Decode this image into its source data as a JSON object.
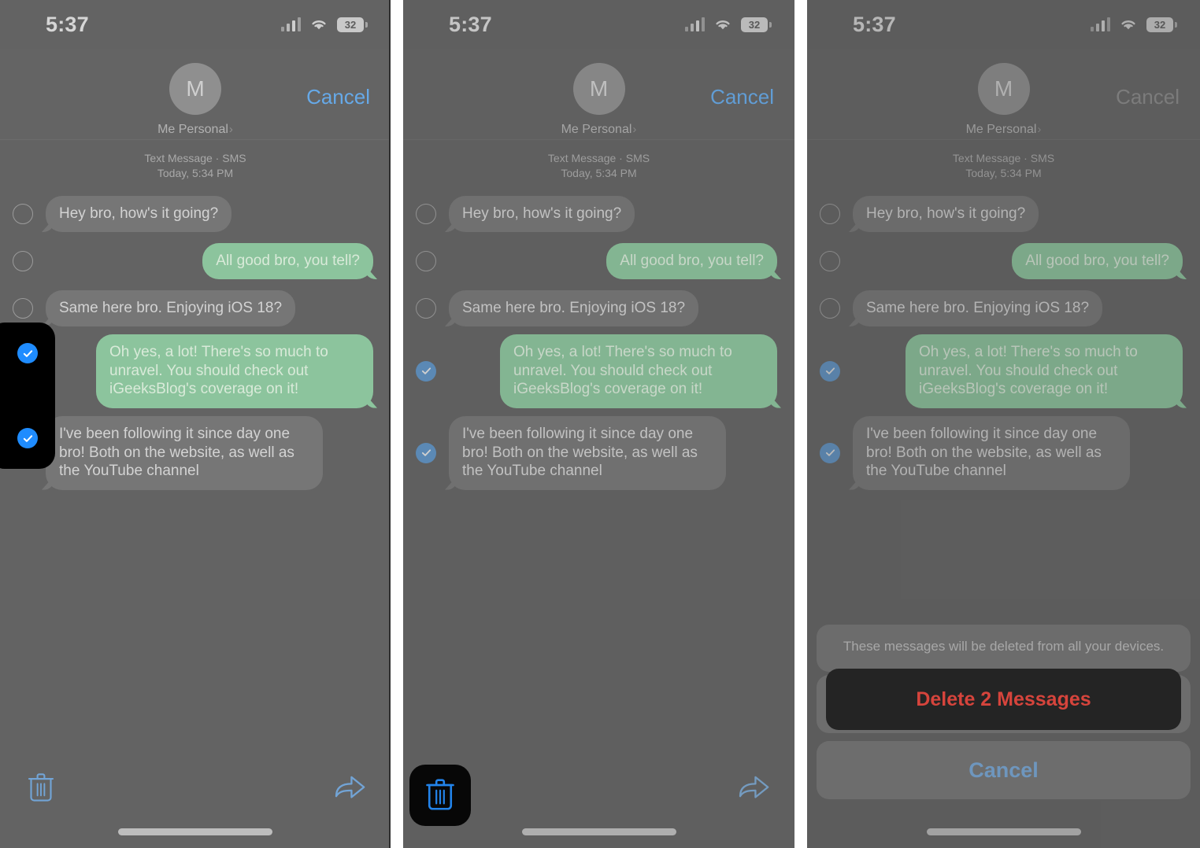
{
  "status_bar": {
    "time": "5:37",
    "battery_percent": "32",
    "cellular_icon": "cellular-signal-icon",
    "wifi_icon": "wifi-icon",
    "battery_icon": "battery-icon"
  },
  "header": {
    "avatar_initial": "M",
    "contact_name": "Me Personal",
    "chevron": "›",
    "cancel_label": "Cancel"
  },
  "thread": {
    "service_line": "Text Message · SMS",
    "timestamp_line": "Today, 5:34 PM",
    "messages": [
      {
        "id": "m1",
        "side": "them",
        "text": "Hey bro, how's it going?",
        "selected": false
      },
      {
        "id": "m2",
        "side": "me",
        "text": "All good bro, you tell?",
        "selected": false
      },
      {
        "id": "m3",
        "side": "them",
        "text": "Same here bro. Enjoying iOS 18?",
        "selected": false
      },
      {
        "id": "m4",
        "side": "me",
        "text": "Oh yes, a lot! There's so much to unravel. You should check out iGeeksBlog's coverage on it!",
        "selected": true
      },
      {
        "id": "m5",
        "side": "them",
        "text": "I've been following it since day one bro! Both on the website, as well as the YouTube channel",
        "selected": true
      }
    ]
  },
  "toolbar": {
    "delete_icon": "trash-icon",
    "forward_icon": "forward-arrow-icon"
  },
  "action_sheet": {
    "message": "These messages will be deleted from all your devices.",
    "delete_label": "Delete 2 Messages",
    "cancel_label": "Cancel"
  },
  "highlights": {
    "step1_target": "message-selection-checkboxes",
    "step2_target": "delete-trash-button",
    "step3_target": "confirm-delete-button"
  },
  "colors": {
    "accent_blue": "#1f8cff",
    "destructive_red": "#ff453a",
    "bubble_me_green": "#8cc49d",
    "bubble_them_gray": "#767676",
    "highlight_black": "#000000",
    "screen_dim_gray": "#636363"
  }
}
